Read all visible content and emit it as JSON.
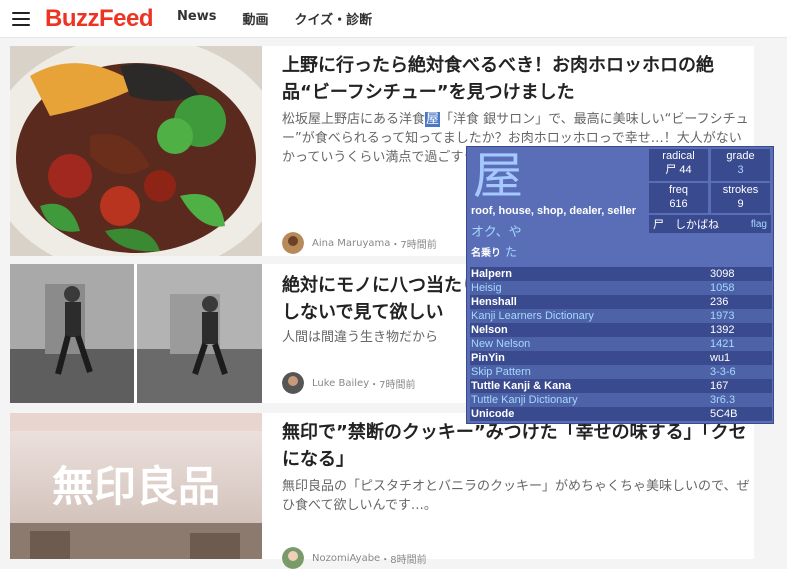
{
  "header": {
    "logo": "BuzzFeed",
    "nav": [
      "News",
      "動画",
      "クイズ・診断"
    ]
  },
  "articles": [
    {
      "title": "上野に行ったら絶対食べるべき！お肉ホロッホロの絶品“ビーフシチュー”を見つけました",
      "desc_before": "松坂屋上野店にある洋食",
      "desc_highlight": "屋",
      "desc_after": "「洋食 銀サロン」で、最高に美味しい“ビーフシチュー”が食べられるって知ってましたか？お肉ホロッホロっで幸せ…！大人がないかっていうくらい満点で過ごすランチタイムは",
      "author": "Aina Maruyama",
      "time": "・7時間前"
    },
    {
      "title": "絶対にモノに八つ当たりしないで見て欲しい",
      "desc": "人間は間違う生き物だから",
      "author": "Luke Bailey",
      "time": "・7時間前"
    },
    {
      "title": "無印で”禁断のクッキー”みつけた「幸せの味する」「クセになる」",
      "desc": "無印良品の「ピスタチオとバニラのクッキー」がめちゃくちゃ美味しいので、ぜひ食べて欲しいんです…。",
      "author": "NozomiAyabe",
      "time": "・8時間前",
      "sign_text": "無印良品"
    }
  ],
  "kanji_popup": {
    "kanji": "屋",
    "meaning": "roof, house, shop, dealer, seller",
    "onyomi": "オク、や",
    "nanori_label": "名乗り",
    "nanori": "た",
    "radical_label": "radical",
    "radical_value": "尸 44",
    "grade_label": "grade",
    "grade_value": "3",
    "freq_label": "freq",
    "freq_value": "616",
    "strokes_label": "strokes",
    "strokes_value": "9",
    "radical_name": "尸　しかばね",
    "flag_label": "flag",
    "references": [
      {
        "name": "Halpern",
        "value": "3098",
        "link": false
      },
      {
        "name": "Heisig",
        "value": "1058",
        "link": true
      },
      {
        "name": "Henshall",
        "value": "236",
        "link": false
      },
      {
        "name": "Kanji Learners Dictionary",
        "value": "1973",
        "link": true
      },
      {
        "name": "Nelson",
        "value": "1392",
        "link": false
      },
      {
        "name": "New Nelson",
        "value": "1421",
        "link": true
      },
      {
        "name": "PinYin",
        "value": "wu1",
        "link": false
      },
      {
        "name": "Skip Pattern",
        "value": "3-3-6",
        "link": true
      },
      {
        "name": "Tuttle Kanji & Kana",
        "value": "167",
        "link": false
      },
      {
        "name": "Tuttle Kanji Dictionary",
        "value": "3r6.3",
        "link": true
      },
      {
        "name": "Unicode",
        "value": "5C4B",
        "link": false
      }
    ]
  }
}
